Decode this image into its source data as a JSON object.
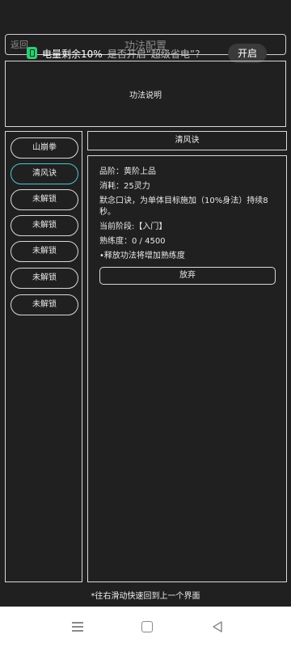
{
  "header": {
    "back": "返回",
    "title": "功法配置"
  },
  "notification": {
    "icon": "battery-icon",
    "text": "电量剩余10%",
    "question": "是否开启“超级省电”?",
    "action": "开启"
  },
  "description": {
    "text": "功法说明"
  },
  "techniques": [
    {
      "label": "山崩拳",
      "selected": false
    },
    {
      "label": "清风诀",
      "selected": true
    },
    {
      "label": "未解锁",
      "selected": false
    },
    {
      "label": "未解锁",
      "selected": false
    },
    {
      "label": "未解锁",
      "selected": false
    },
    {
      "label": "未解锁",
      "selected": false
    },
    {
      "label": "未解锁",
      "selected": false
    }
  ],
  "detail": {
    "name": "清风诀",
    "grade": "品阶：黄阶上品",
    "cost": "消耗：25灵力",
    "effect": "默念口诀，为单体目标施加（10%身法）持续8秒。",
    "stage": "当前阶段:【入门】",
    "proficiency": "熟练度：0 / 4500",
    "tip": "•释放功法将增加熟练度",
    "abandon": "放弃"
  },
  "footer_hint": "*往右滑动快速回到上一个界面",
  "colors": {
    "background": "#202020",
    "border": "#d9d9d9",
    "selected": "#4fc3d6",
    "battery": "#2ecc71"
  },
  "navbar": {
    "icons": [
      "menu-icon",
      "home-icon",
      "back-icon"
    ]
  }
}
